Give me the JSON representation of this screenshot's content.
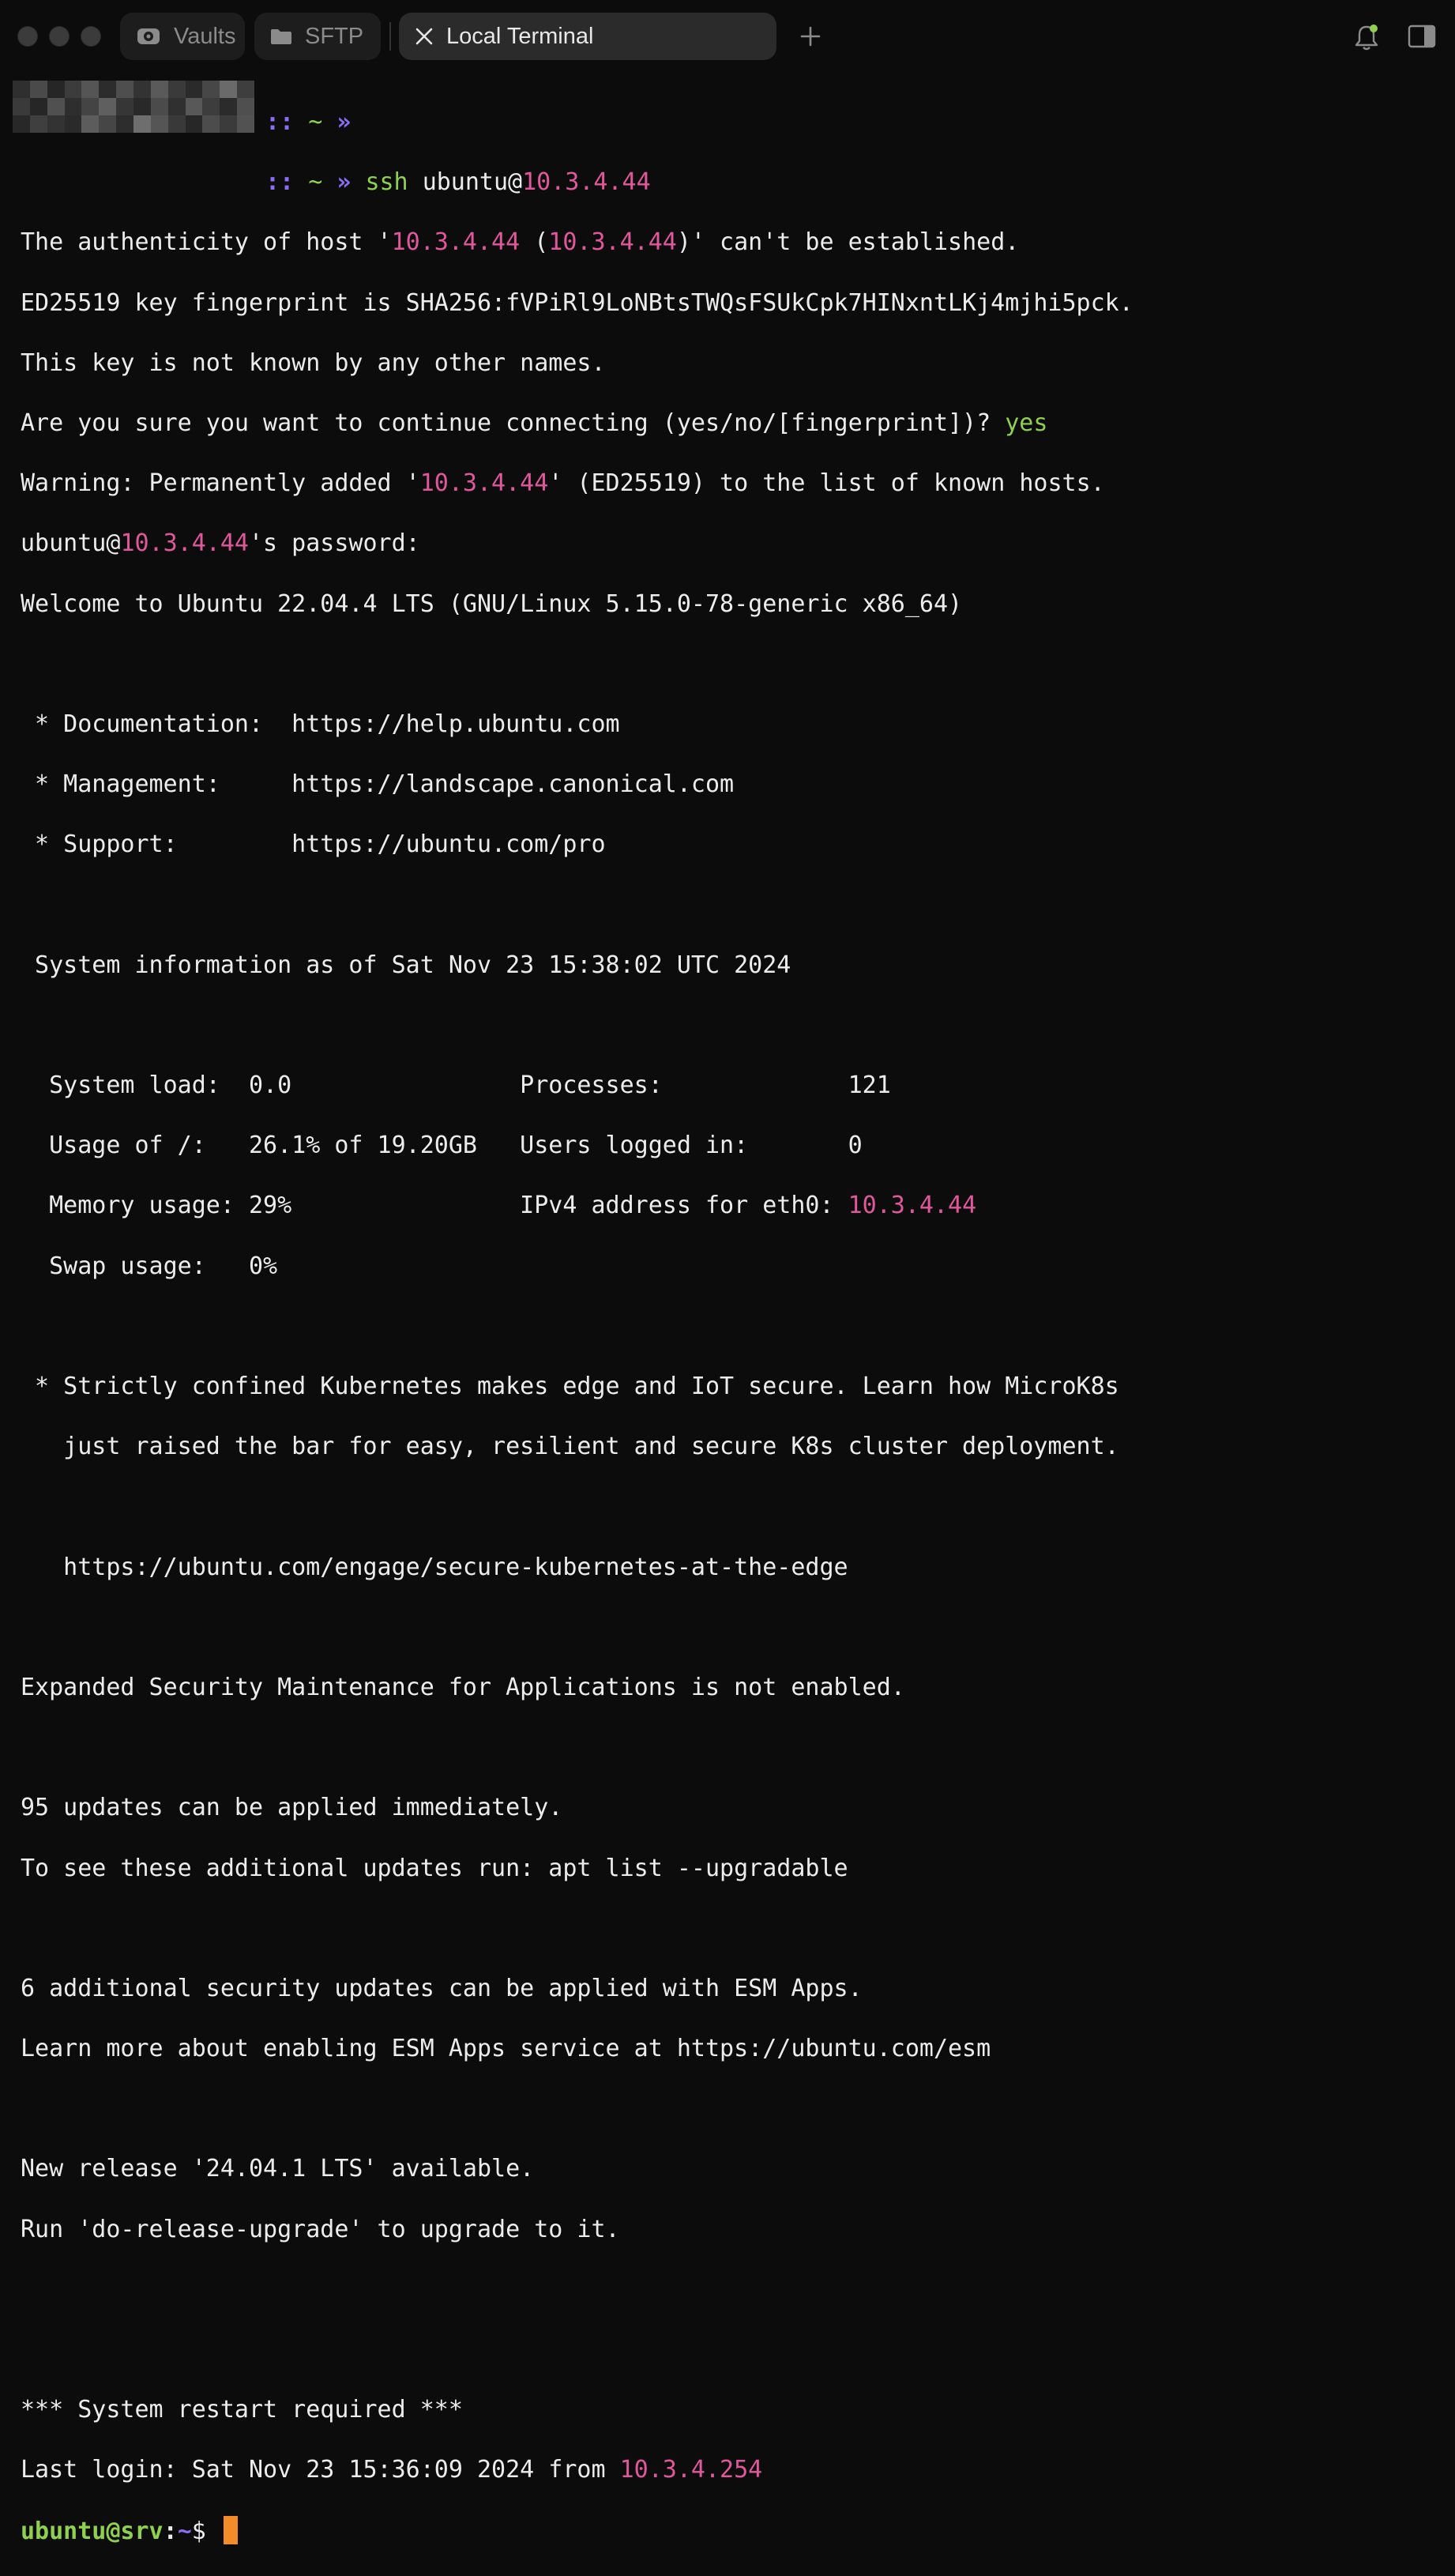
{
  "window": {
    "tabs": [
      {
        "label": "Vaults",
        "icon": "vault-icon"
      },
      {
        "label": "SFTP",
        "icon": "folder-icon"
      },
      {
        "label": "Local Terminal",
        "icon": "close-icon"
      }
    ],
    "new_tab_icon": "plus-icon",
    "notifications_icon": "bell-icon",
    "sidebar_icon": "sidebar-toggle-icon"
  },
  "colors": {
    "ip": "#e0579b",
    "prompt_green": "#8fd14f",
    "prompt_purple": "#8b6cf5",
    "cursor": "#f28c28"
  },
  "terminal": {
    "prompt1": {
      "dots": "::",
      "tilde": "~",
      "arrow": "»"
    },
    "prompt2": {
      "dots": "::",
      "tilde": "~",
      "arrow": "»",
      "cmd": "ssh",
      "user_at": "ubuntu@",
      "host": "10.3.4.44"
    },
    "l1": {
      "a": "The authenticity of host '",
      "ip1": "10.3.4.44",
      "b": " (",
      "ip2": "10.3.4.44",
      "c": ")' can't be established."
    },
    "l2": "ED25519 key fingerprint is SHA256:fVPiRl9LoNBtsTWQsFSUkCpk7HINxntLKj4mjhi5pck.",
    "l3": "This key is not known by any other names.",
    "l4": {
      "a": "Are you sure you want to continue connecting (yes/no/[fingerprint])? ",
      "yes": "yes"
    },
    "l5": {
      "a": "Warning: Permanently added '",
      "ip": "10.3.4.44",
      "b": "' (ED25519) to the list of known hosts."
    },
    "l6": {
      "a": "ubuntu@",
      "ip": "10.3.4.44",
      "b": "'s password:"
    },
    "l7": "Welcome to Ubuntu 22.04.4 LTS (GNU/Linux 5.15.0-78-generic x86_64)",
    "doc": " * Documentation:  https://help.ubuntu.com",
    "mgmt": " * Management:     https://landscape.canonical.com",
    "support": " * Support:        https://ubuntu.com/pro",
    "sysinfo": " System information as of Sat Nov 23 15:38:02 UTC 2024",
    "s1": "  System load:  0.0                Processes:             121",
    "s2": "  Usage of /:   26.1% of 19.20GB   Users logged in:       0",
    "s3": {
      "a": "  Memory usage: 29%                IPv4 address for eth0: ",
      "ip": "10.3.4.44"
    },
    "s4": "  Swap usage:   0%",
    "k1": " * Strictly confined Kubernetes makes edge and IoT secure. Learn how MicroK8s",
    "k2": "   just raised the bar for easy, resilient and secure K8s cluster deployment.",
    "k3": "   https://ubuntu.com/engage/secure-kubernetes-at-the-edge",
    "esm": "Expanded Security Maintenance for Applications is not enabled.",
    "u1": "95 updates can be applied immediately.",
    "u2": "To see these additional updates run: apt list --upgradable",
    "e1": "6 additional security updates can be applied with ESM Apps.",
    "e2": "Learn more about enabling ESM Apps service at https://ubuntu.com/esm",
    "r1": "New release '24.04.1 LTS' available.",
    "r2": "Run 'do-release-upgrade' to upgrade to it.",
    "restart": "*** System restart required ***",
    "last": {
      "a": "Last login: Sat Nov 23 15:36:09 2024 from ",
      "ip": "10.3.4.254"
    },
    "final_prompt": {
      "user": "ubuntu@srv",
      "colon": ":",
      "path": "~",
      "dollar": "$"
    }
  }
}
